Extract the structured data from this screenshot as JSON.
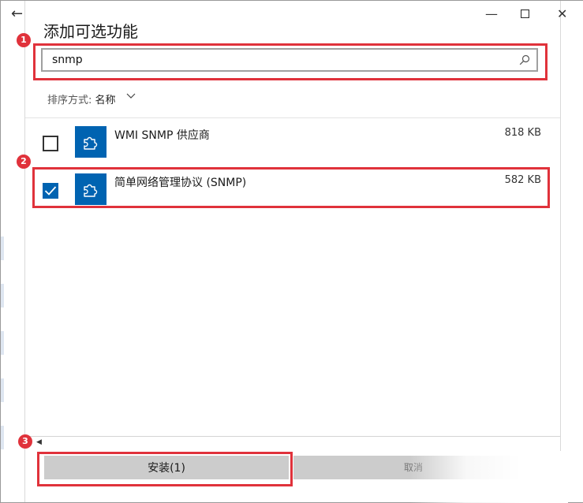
{
  "window": {
    "title": "添加可选功能",
    "back_label": "←",
    "minimize_label": "—",
    "maximize_label": "☐",
    "close_label": "✕"
  },
  "search": {
    "value": "snmp",
    "icon": "search-icon"
  },
  "sort": {
    "label": "排序方式:",
    "value": "名称"
  },
  "features": [
    {
      "name": "WMI SNMP 供应商",
      "size": "818 KB",
      "checked": false,
      "icon": "puzzle-icon"
    },
    {
      "name": "简单网络管理协议 (SNMP)",
      "size": "582 KB",
      "checked": true,
      "icon": "puzzle-icon"
    }
  ],
  "buttons": {
    "install_label": "安装(1)",
    "cancel_label": "取消"
  },
  "annotations": {
    "markers": [
      "1",
      "2",
      "3"
    ],
    "color": "#e0323b"
  },
  "colors": {
    "accent": "#0063b1",
    "button_bg": "#cccccc"
  }
}
